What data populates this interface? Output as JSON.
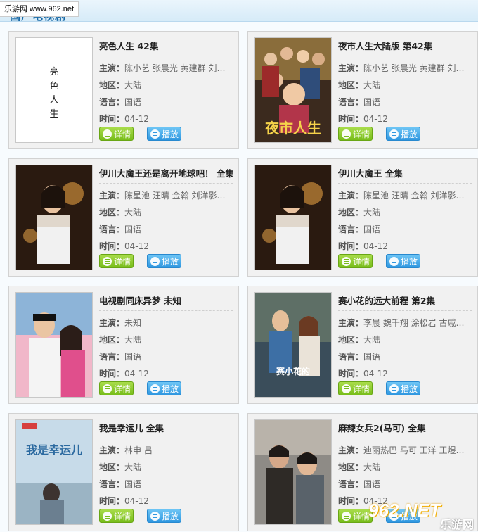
{
  "watermark_top": "乐游网 www.962.net",
  "section_title": "国产电视剧",
  "labels": {
    "cast": "主演：",
    "region": "地区：",
    "language": "语言：",
    "time": "时间："
  },
  "buttons": {
    "detail": "详情",
    "play": "播放"
  },
  "shows": [
    {
      "title": "亮色人生  42集",
      "cast": "陈小艺 张晨光 黄建群 刘…",
      "region": "大陆",
      "language": "国语",
      "time": "04-12",
      "poster_text": "亮色人生"
    },
    {
      "title": "夜市人生大陆版  第42集",
      "cast": "陈小艺 张晨光 黄建群 刘…",
      "region": "大陆",
      "language": "国语",
      "time": "04-12",
      "poster_text": "夜市人生"
    },
    {
      "title": "伊川大魔王还是离开地球吧！  全集",
      "cast": "陈星池 汪晴 金翰 刘洋影…",
      "region": "大陆",
      "language": "国语",
      "time": "04-12",
      "poster_text": ""
    },
    {
      "title": "伊川大魔王  全集",
      "cast": "陈星池 汪晴 金翰 刘洋影…",
      "region": "大陆",
      "language": "国语",
      "time": "04-12",
      "poster_text": ""
    },
    {
      "title": "电视剧同床异梦  未知",
      "cast": "未知",
      "region": "大陆",
      "language": "国语",
      "time": "04-12",
      "poster_text": ""
    },
    {
      "title": "赛小花的远大前程  第2集",
      "cast": "李晨 魏千翔 涂松岩 古戚…",
      "region": "大陆",
      "language": "国语",
      "time": "04-12",
      "poster_text": "赛小花的"
    },
    {
      "title": "我是幸运儿  全集",
      "cast": "林申 吕一",
      "region": "大陆",
      "language": "国语",
      "time": "04-12",
      "poster_text": "我是幸运儿"
    },
    {
      "title": "麻辣女兵2(马可)  全集",
      "cast": "迪丽热巴 马可 王洋 王煜…",
      "region": "大陆",
      "language": "国语",
      "time": "04-12",
      "poster_text": ""
    }
  ],
  "watermark_bottom": {
    "big": "962.NET",
    "small": "乐游网"
  },
  "colors": {
    "detail_button": "#78bd1b",
    "play_button": "#2f97e0",
    "title_blue": "#1a6aa6"
  }
}
